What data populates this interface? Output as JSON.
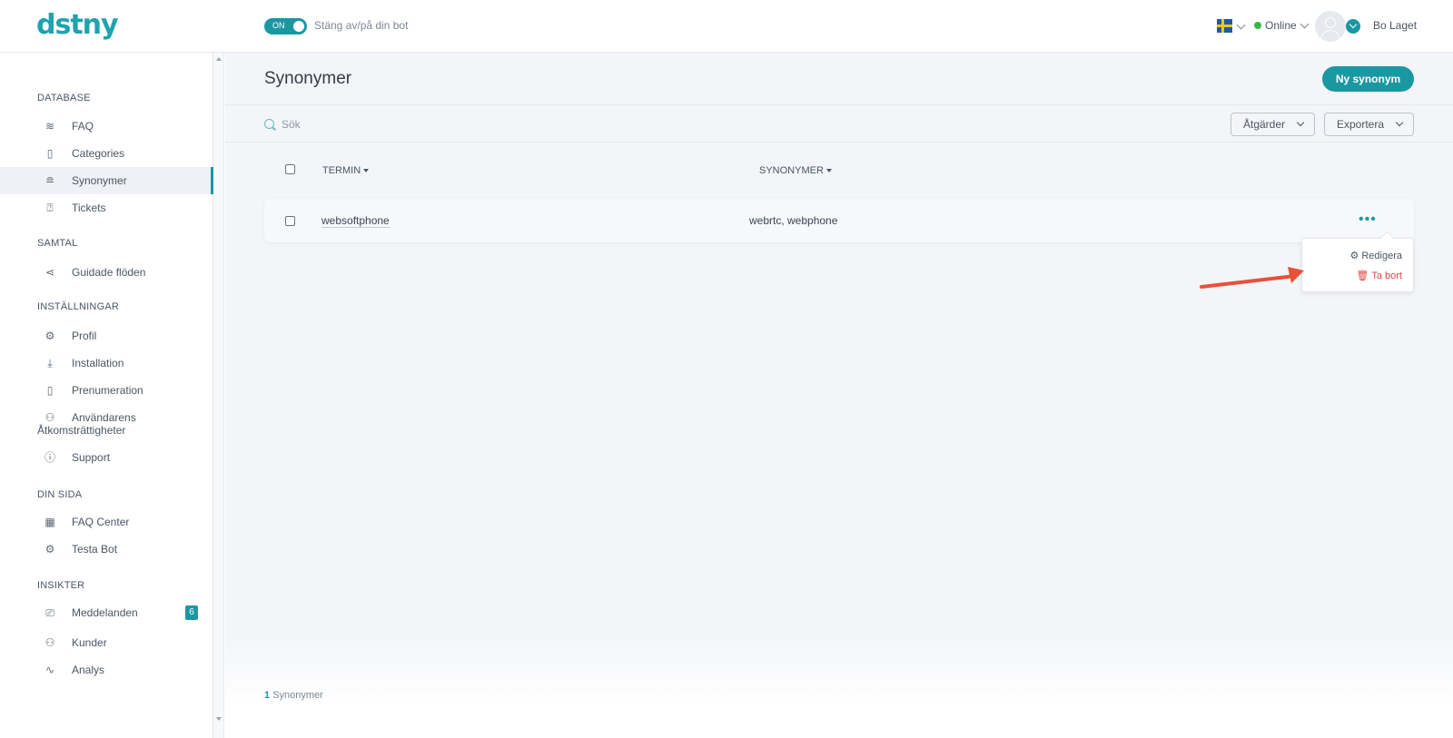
{
  "header": {
    "logo": "dstny",
    "toggle_state": "ON",
    "toggle_label": "Stäng av/på din bot",
    "language": "sv",
    "status": "Online",
    "user_name": "Bo Laget",
    "accent": "#1a98a2"
  },
  "sidebar": {
    "sections": [
      {
        "title": "DATABASE",
        "items": [
          {
            "label": "FAQ",
            "icon": "layers-icon"
          },
          {
            "label": "Categories",
            "icon": "clipboard-icon"
          },
          {
            "label": "Synonymer",
            "icon": "synonyms-icon",
            "active": true
          },
          {
            "label": "Tickets",
            "icon": "help-circle-icon"
          }
        ]
      },
      {
        "title": "SAMTAL",
        "items": [
          {
            "label": "Guidade flöden",
            "icon": "share-icon"
          }
        ]
      },
      {
        "title": "INSTÄLLNINGAR",
        "items": [
          {
            "label": "Profil",
            "icon": "gear-icon"
          },
          {
            "label": "Installation",
            "icon": "download-icon"
          },
          {
            "label": "Prenumeration",
            "icon": "clipboard-icon"
          },
          {
            "label": "Användarens",
            "label2": "Åtkomsträttigheter",
            "icon": "users-icon"
          },
          {
            "label": "Support",
            "icon": "info-icon"
          }
        ]
      },
      {
        "title": "DIN SIDA",
        "items": [
          {
            "label": "FAQ Center",
            "icon": "grid-icon"
          },
          {
            "label": "Testa Bot",
            "icon": "gears-icon"
          }
        ]
      },
      {
        "title": "INSIKTER",
        "items": [
          {
            "label": "Meddelanden",
            "icon": "chat-icon",
            "badge": "6"
          },
          {
            "label": "Kunder",
            "icon": "users-icon"
          },
          {
            "label": "Analys",
            "icon": "activity-icon"
          }
        ]
      }
    ]
  },
  "main": {
    "title": "Synonymer",
    "new_button": "Ny synonym",
    "search_placeholder": "Sök",
    "actions_label": "Åtgärder",
    "export_label": "Exportera",
    "columns": [
      "TERMIN",
      "SYNONYMER"
    ],
    "rows": [
      {
        "term": "websoftphone",
        "synonyms": "webrtc, webphone"
      }
    ],
    "row_menu": {
      "edit": "Redigera",
      "delete": "Ta bort"
    },
    "footer_count": "1",
    "footer_label": "Synonymer"
  }
}
